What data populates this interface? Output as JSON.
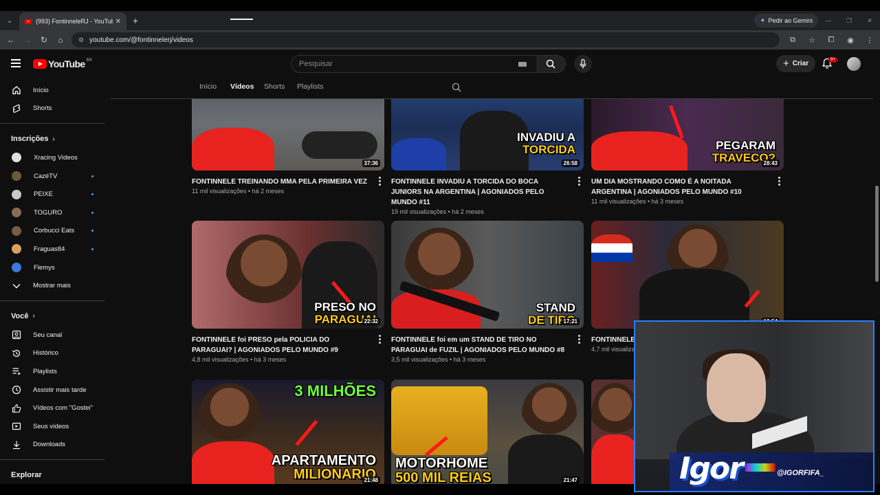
{
  "browser": {
    "tab_title": "(993) FontinneleRJ - YouTube",
    "tab_close": "✕",
    "new_tab": "+",
    "gemini_label": "Pedir ao Gemini",
    "url": "youtube.com/@fontinnelerj/videos"
  },
  "header": {
    "logo_text": "YouTube",
    "country_code": "BR",
    "search_placeholder": "Pesquisar",
    "create_label": "Criar",
    "notifications_badge": "9+"
  },
  "sidebar": {
    "main": [
      {
        "label": "Início",
        "icon": "home-icon"
      },
      {
        "label": "Shorts",
        "icon": "shorts-icon"
      }
    ],
    "subscriptions_heading": "Inscrições",
    "subscriptions": [
      {
        "label": "Xracing Videos",
        "color": "#e0e0e0",
        "dot": false
      },
      {
        "label": "CazéTV",
        "color": "#6b5a3a",
        "dot": true
      },
      {
        "label": "PEIXE",
        "color": "#c8c8c8",
        "dot": true
      },
      {
        "label": "TOGURO",
        "color": "#8a6a55",
        "dot": true
      },
      {
        "label": "Corbucci Eats",
        "color": "#7a5a40",
        "dot": true
      },
      {
        "label": "Fraguas84",
        "color": "#d8a060",
        "dot": true
      },
      {
        "label": "Flemys",
        "color": "#3a7ad8",
        "dot": false
      }
    ],
    "show_more": "Mostrar mais",
    "you_heading": "Você",
    "you_items": [
      {
        "label": "Seu canal",
        "icon": "channel-icon"
      },
      {
        "label": "Histórico",
        "icon": "history-icon"
      },
      {
        "label": "Playlists",
        "icon": "playlists-icon"
      },
      {
        "label": "Assistir mais tarde",
        "icon": "watch-later-icon"
      },
      {
        "label": "Vídeos com \"Gostei\"",
        "icon": "liked-icon"
      },
      {
        "label": "Seus vídeos",
        "icon": "your-videos-icon"
      },
      {
        "label": "Downloads",
        "icon": "downloads-icon"
      }
    ],
    "explore_heading": "Explorar"
  },
  "channel_tabs": [
    "Início",
    "Vídeos",
    "Shorts",
    "Playlists"
  ],
  "videos": [
    {
      "title": "FONTINNELE TREINANDO MMA PELA PRIMEIRA VEZ",
      "meta": "11 mil visualizações • há 2 meses",
      "duration": "37:36",
      "caption1": "",
      "caption2": "",
      "bg": "#5a5f66"
    },
    {
      "title": "FONTINNELE INVADIU A TORCIDA DO BOCA JUNIORS NA ARGENTINA | AGONIADOS PELO MUNDO #11",
      "meta": "19 mil visualizações • há 2 meses",
      "duration": "26:58",
      "caption1": "INVADIU A",
      "caption2": "TORCIDA",
      "bg": "#1f3a6a"
    },
    {
      "title": "UM DIA MOSTRANDO COMO É A NOITADA ARGENTINA | AGONIADOS PELO MUNDO #10",
      "meta": "11 mil visualizações • há 3 meses",
      "duration": "28:43",
      "caption1": "PEGARAM",
      "caption2": "TRAVECO?",
      "bg": "#3a2a44"
    },
    {
      "title": "FONTINNELE foi PRESO pela POLICIA DO PARAGUAI? | AGONIADOS PELO MUNDO #9",
      "meta": "4,8 mil visualizações • há 3 meses",
      "duration": "22:32",
      "caption1": "PRESO NO",
      "caption2": "PARAGUAI",
      "bg": "#8a5a5a"
    },
    {
      "title": "FONTINNELE foi em um STAND DE TIRO NO PARAGUAI de FUZIL | AGONIADOS PELO MUNDO #8",
      "meta": "3,5 mil visualizações • há 3 meses",
      "duration": "17:21",
      "caption1": "STAND",
      "caption2": "DE TIRO",
      "bg": "#4a4f55"
    },
    {
      "title": "FONTINNELE ... SURPREENDI...",
      "meta": "4,7 mil visualiza...",
      "duration": "12:54",
      "caption1": "",
      "caption2": "",
      "bg": "#6a3030"
    },
    {
      "title": "",
      "meta": "",
      "duration": "21:48",
      "caption1": "APARTAMENTO",
      "caption2": "MILIONARIO",
      "top_caption": "3 MILHÕES",
      "bg": "#3a2f28"
    },
    {
      "title": "",
      "meta": "",
      "duration": "21:47",
      "caption1": "MOTORHOME",
      "caption2": "500 MIL REIAS",
      "bg": "#5a5a4a"
    },
    {
      "title": "",
      "meta": "",
      "duration": "",
      "caption1": "",
      "caption2": "",
      "bg": "#5a3030"
    }
  ],
  "webcam": {
    "logo": "Igor",
    "handle": "@IGORFIFA_"
  }
}
